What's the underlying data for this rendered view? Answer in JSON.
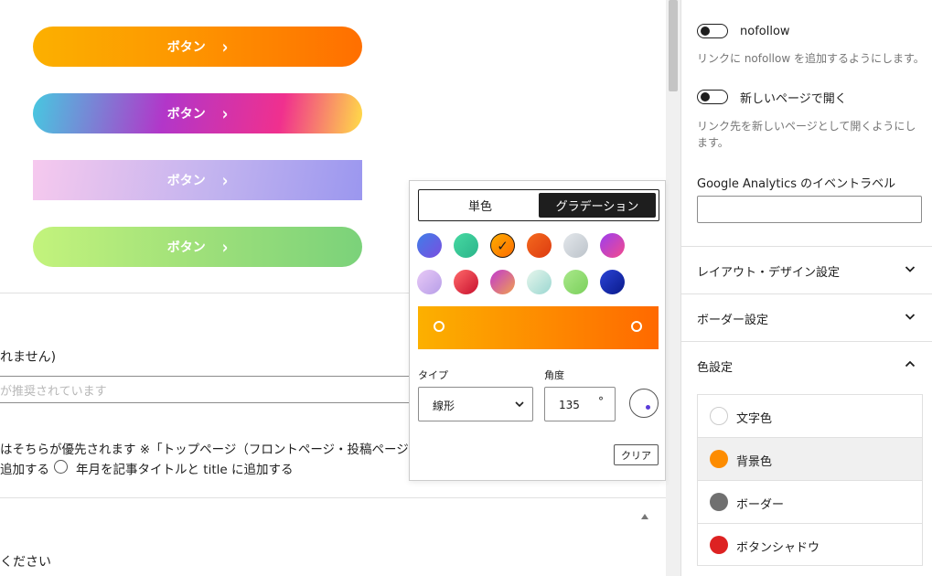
{
  "editor": {
    "buttons": [
      {
        "label": "ボタン",
        "chevron": "›"
      },
      {
        "label": "ボタン",
        "chevron": "›"
      },
      {
        "label": "ボタン",
        "chevron": "›"
      },
      {
        "label": "ボタン",
        "chevron": "›"
      }
    ],
    "note_fragment": "れません)",
    "input_placeholder_fragment": "が推奨されています",
    "priority_text": "はそちらが優先されます ※「トップページ（フロントページ・投稿ページ含む",
    "radio_prefix": "追加する",
    "radio_option_label": "年月を記事タイトルと title に追加する",
    "bottom_text": "ください"
  },
  "popover": {
    "tabs": [
      "単色",
      "グラデーション"
    ],
    "active_tab": "グラデーション",
    "gradients": [
      {
        "name": "blue-purple",
        "from": "#3f7ee8",
        "to": "#7a4ee0"
      },
      {
        "name": "green",
        "from": "#47d9a2",
        "to": "#2bb48a"
      },
      {
        "name": "orange",
        "from": "#fcb000",
        "to": "#ff6900",
        "selected": true
      },
      {
        "name": "red-orange",
        "from": "#f46a1e",
        "to": "#dd3a10"
      },
      {
        "name": "silver",
        "from": "#e3e7eb",
        "to": "#bcc3ca"
      },
      {
        "name": "purple-pink",
        "from": "#9b3ef0",
        "to": "#f54a8c"
      },
      {
        "name": "lavender",
        "from": "#e8c9f6",
        "to": "#b79ee8"
      },
      {
        "name": "red",
        "from": "#ff6a6a",
        "to": "#c8102e"
      },
      {
        "name": "magenta-orange",
        "from": "#c03ad0",
        "to": "#f0a050"
      },
      {
        "name": "mint",
        "from": "#e6f6ec",
        "to": "#9bd7d1"
      },
      {
        "name": "light-green",
        "from": "#a9e88a",
        "to": "#7bd05c"
      },
      {
        "name": "navy",
        "from": "#2a43d6",
        "to": "#0a1a8a"
      }
    ],
    "bar_from": "#fcb000",
    "bar_to": "#ff6900",
    "type_label": "タイプ",
    "type_value": "線形",
    "angle_label": "角度",
    "angle_value": "135",
    "angle_unit": "°",
    "clear_label": "クリア"
  },
  "sidebar": {
    "nofollow_label": "nofollow",
    "nofollow_help": "リンクに nofollow を追加するようにします。",
    "newtab_label": "新しいページで開く",
    "newtab_help": "リンク先を新しいページとして開くようにします。",
    "ga_label": "Google Analytics のイベントラベル",
    "ga_value": "",
    "panels": {
      "layout": "レイアウト・デザイン設定",
      "border": "ボーダー設定",
      "color": "色設定"
    },
    "color_items": [
      {
        "label": "文字色",
        "color": "#ffffff"
      },
      {
        "label": "背景色",
        "color": "#fd8c00"
      },
      {
        "label": "ボーダー",
        "color": "#707070"
      },
      {
        "label": "ボタンシャドウ",
        "color": "#dd2222"
      }
    ]
  }
}
